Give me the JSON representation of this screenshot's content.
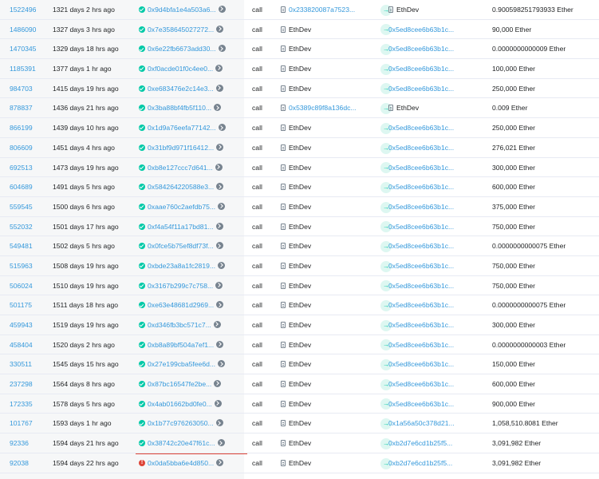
{
  "colors": {
    "link": "#3498db",
    "success": "#00c9a7",
    "error": "#de4437"
  },
  "rows": [
    {
      "block": "1522496",
      "age": "1321 days 2 hrs ago",
      "txn": "0x9d4bfa1e4a503a6...",
      "status": "success",
      "type": "call",
      "from": "0x233820087a7523...",
      "from_icon": "contract-icon",
      "to": "EthDev",
      "to_icon": "contract-icon",
      "value": "0.900598251793933 Ether"
    },
    {
      "block": "1486090",
      "age": "1327 days 3 hrs ago",
      "txn": "0x7e358645027272...",
      "status": "success",
      "type": "call",
      "from": "EthDev",
      "from_icon": "contract-icon",
      "to": "0x5ed8cee6b63b1c...",
      "to_icon": "",
      "value": "90,000 Ether"
    },
    {
      "block": "1470345",
      "age": "1329 days 18 hrs ago",
      "txn": "0x6e22fb6673add30...",
      "status": "success",
      "type": "call",
      "from": "EthDev",
      "from_icon": "contract-icon",
      "to": "0x5ed8cee6b63b1c...",
      "to_icon": "",
      "value": "0.0000000000009 Ether"
    },
    {
      "block": "1185391",
      "age": "1377 days 1 hr ago",
      "txn": "0xf0acde01f0c4ee0...",
      "status": "success",
      "type": "call",
      "from": "EthDev",
      "from_icon": "contract-icon",
      "to": "0x5ed8cee6b63b1c...",
      "to_icon": "",
      "value": "100,000 Ether"
    },
    {
      "block": "984703",
      "age": "1415 days 19 hrs ago",
      "txn": "0xe683476e2c14e3...",
      "status": "success",
      "type": "call",
      "from": "EthDev",
      "from_icon": "contract-icon",
      "to": "0x5ed8cee6b63b1c...",
      "to_icon": "",
      "value": "250,000 Ether"
    },
    {
      "block": "878837",
      "age": "1436 days 21 hrs ago",
      "txn": "0x3ba88bf4fb5f110...",
      "status": "success",
      "type": "call",
      "from": "0x5389c89f8a136dc...",
      "from_icon": "contract-icon",
      "to": "EthDev",
      "to_icon": "contract-icon",
      "value": "0.009 Ether"
    },
    {
      "block": "866199",
      "age": "1439 days 10 hrs ago",
      "txn": "0x1d9a76eefa77142...",
      "status": "success",
      "type": "call",
      "from": "EthDev",
      "from_icon": "contract-icon",
      "to": "0x5ed8cee6b63b1c...",
      "to_icon": "",
      "value": "250,000 Ether"
    },
    {
      "block": "806609",
      "age": "1451 days 4 hrs ago",
      "txn": "0x31bf9d971f16412...",
      "status": "success",
      "type": "call",
      "from": "EthDev",
      "from_icon": "contract-icon",
      "to": "0x5ed8cee6b63b1c...",
      "to_icon": "",
      "value": "276,021 Ether"
    },
    {
      "block": "692513",
      "age": "1473 days 19 hrs ago",
      "txn": "0xb8e127ccc7d641...",
      "status": "success",
      "type": "call",
      "from": "EthDev",
      "from_icon": "contract-icon",
      "to": "0x5ed8cee6b63b1c...",
      "to_icon": "",
      "value": "300,000 Ether"
    },
    {
      "block": "604689",
      "age": "1491 days 5 hrs ago",
      "txn": "0x584264220588e3...",
      "status": "success",
      "type": "call",
      "from": "EthDev",
      "from_icon": "contract-icon",
      "to": "0x5ed8cee6b63b1c...",
      "to_icon": "",
      "value": "600,000 Ether"
    },
    {
      "block": "559545",
      "age": "1500 days 6 hrs ago",
      "txn": "0xaae760c2aefdb75...",
      "status": "success",
      "type": "call",
      "from": "EthDev",
      "from_icon": "contract-icon",
      "to": "0x5ed8cee6b63b1c...",
      "to_icon": "",
      "value": "375,000 Ether"
    },
    {
      "block": "552032",
      "age": "1501 days 17 hrs ago",
      "txn": "0xf4a54f11a17bd81...",
      "status": "success",
      "type": "call",
      "from": "EthDev",
      "from_icon": "contract-icon",
      "to": "0x5ed8cee6b63b1c...",
      "to_icon": "",
      "value": "750,000 Ether"
    },
    {
      "block": "549481",
      "age": "1502 days 5 hrs ago",
      "txn": "0x0fce5b75ef8df73f...",
      "status": "success",
      "type": "call",
      "from": "EthDev",
      "from_icon": "contract-icon",
      "to": "0x5ed8cee6b63b1c...",
      "to_icon": "",
      "value": "0.0000000000075 Ether"
    },
    {
      "block": "515963",
      "age": "1508 days 19 hrs ago",
      "txn": "0xbde23a8a1fc2819...",
      "status": "success",
      "type": "call",
      "from": "EthDev",
      "from_icon": "contract-icon",
      "to": "0x5ed8cee6b63b1c...",
      "to_icon": "",
      "value": "750,000 Ether"
    },
    {
      "block": "506024",
      "age": "1510 days 19 hrs ago",
      "txn": "0x3167b299c7c758...",
      "status": "success",
      "type": "call",
      "from": "EthDev",
      "from_icon": "contract-icon",
      "to": "0x5ed8cee6b63b1c...",
      "to_icon": "",
      "value": "750,000 Ether"
    },
    {
      "block": "501175",
      "age": "1511 days 18 hrs ago",
      "txn": "0xe63e48681d2969...",
      "status": "success",
      "type": "call",
      "from": "EthDev",
      "from_icon": "contract-icon",
      "to": "0x5ed8cee6b63b1c...",
      "to_icon": "",
      "value": "0.0000000000075 Ether"
    },
    {
      "block": "459943",
      "age": "1519 days 19 hrs ago",
      "txn": "0xd346fb3bc571c7...",
      "status": "success",
      "type": "call",
      "from": "EthDev",
      "from_icon": "contract-icon",
      "to": "0x5ed8cee6b63b1c...",
      "to_icon": "",
      "value": "300,000 Ether"
    },
    {
      "block": "458404",
      "age": "1520 days 2 hrs ago",
      "txn": "0xb8a89bf504a7ef1...",
      "status": "success",
      "type": "call",
      "from": "EthDev",
      "from_icon": "contract-icon",
      "to": "0x5ed8cee6b63b1c...",
      "to_icon": "",
      "value": "0.0000000000003 Ether"
    },
    {
      "block": "330511",
      "age": "1545 days 15 hrs ago",
      "txn": "0x27e199cba5fee6d...",
      "status": "success",
      "type": "call",
      "from": "EthDev",
      "from_icon": "contract-icon",
      "to": "0x5ed8cee6b63b1c...",
      "to_icon": "",
      "value": "150,000 Ether"
    },
    {
      "block": "237298",
      "age": "1564 days 8 hrs ago",
      "txn": "0x87bc16547fe2be...",
      "status": "success",
      "type": "call",
      "from": "EthDev",
      "from_icon": "contract-icon",
      "to": "0x5ed8cee6b63b1c...",
      "to_icon": "",
      "value": "600,000 Ether"
    },
    {
      "block": "172335",
      "age": "1578 days 5 hrs ago",
      "txn": "0x4ab01662bd0fe0...",
      "status": "success",
      "type": "call",
      "from": "EthDev",
      "from_icon": "contract-icon",
      "to": "0x5ed8cee6b63b1c...",
      "to_icon": "",
      "value": "900,000 Ether"
    },
    {
      "block": "101767",
      "age": "1593 days 1 hr ago",
      "txn": "0x1b77c976263050...",
      "status": "success",
      "type": "call",
      "from": "EthDev",
      "from_icon": "contract-icon",
      "to": "0x1a56a50c378d21...",
      "to_icon": "",
      "value": "1,058,510.8081 Ether"
    },
    {
      "block": "92336",
      "age": "1594 days 21 hrs ago",
      "txn": "0x38742c20e47f61c...",
      "status": "success",
      "type": "call",
      "from": "EthDev",
      "from_icon": "contract-icon",
      "to": "0xb2d7e6cd1b25f5...",
      "to_icon": "",
      "value": "3,091,982 Ether"
    },
    {
      "block": "92038",
      "age": "1594 days 22 hrs ago",
      "txn": "0x0da5bba6e4d850...",
      "status": "error",
      "type": "call",
      "from": "EthDev",
      "from_icon": "contract-icon",
      "to": "0xb2d7e6cd1b25f5...",
      "to_icon": "",
      "value": "3,091,982 Ether"
    }
  ]
}
